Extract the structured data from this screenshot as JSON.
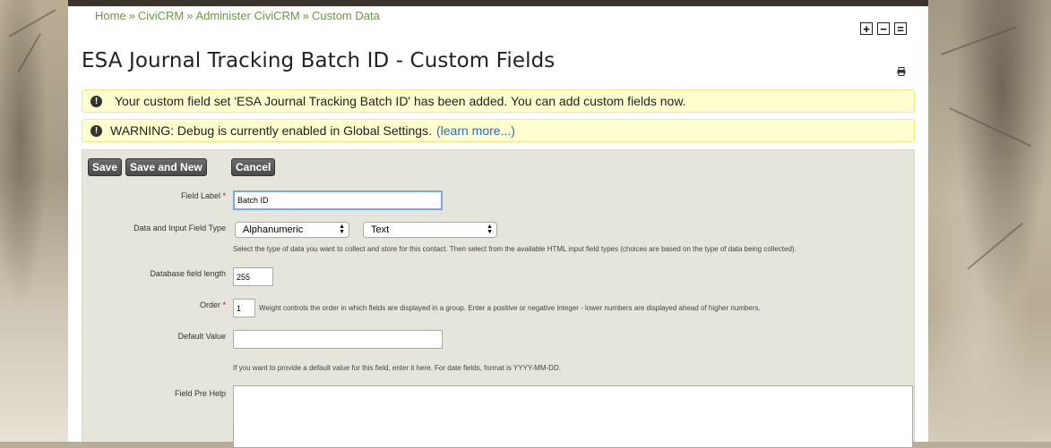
{
  "breadcrumb": {
    "items": [
      "Home",
      "CiviCRM",
      "Administer CiviCRM",
      "Custom Data"
    ],
    "separator": "»"
  },
  "font_controls": {
    "increase": "+",
    "decrease": "−",
    "reset": "="
  },
  "page": {
    "title": "ESA Journal Tracking Batch ID - Custom Fields",
    "print_icon": "print-icon"
  },
  "messages": {
    "success": "Your custom field set 'ESA Journal Tracking Batch ID' has been added. You can add custom fields now.",
    "warning": "WARNING: Debug is currently enabled in Global Settings.",
    "warning_link": "(learn more...)"
  },
  "buttons": {
    "save": "Save",
    "save_new": "Save and New",
    "cancel": "Cancel"
  },
  "form": {
    "field_label": {
      "label": "Field Label",
      "required": "*",
      "value": "Batch ID"
    },
    "data_type": {
      "label": "Data and Input Field Type",
      "data_value": "Alphanumeric",
      "input_value": "Text",
      "help": "Select the type of data you want to collect and store for this contact. Then select from the available HTML input field types (choices are based on the type of data being collected)."
    },
    "db_length": {
      "label": "Database field length",
      "value": "255"
    },
    "order": {
      "label": "Order",
      "required": "*",
      "value": "1",
      "help": "Weight controls the order in which fields are displayed in a group. Enter a positive or negative integer - lower numbers are displayed ahead of higher numbers."
    },
    "default_value": {
      "label": "Default Value",
      "value": "",
      "help": "If you want to provide a default value for this field, enter it here. For date fields, format is YYYY-MM-DD."
    },
    "pre_help": {
      "label": "Field Pre Help",
      "value": ""
    }
  },
  "colors": {
    "link_green": "#6a9a3a",
    "link_blue": "#2a6cb5",
    "message_bg": "#fffecf",
    "form_bg": "#e6e5dc",
    "required": "#cc0000"
  }
}
